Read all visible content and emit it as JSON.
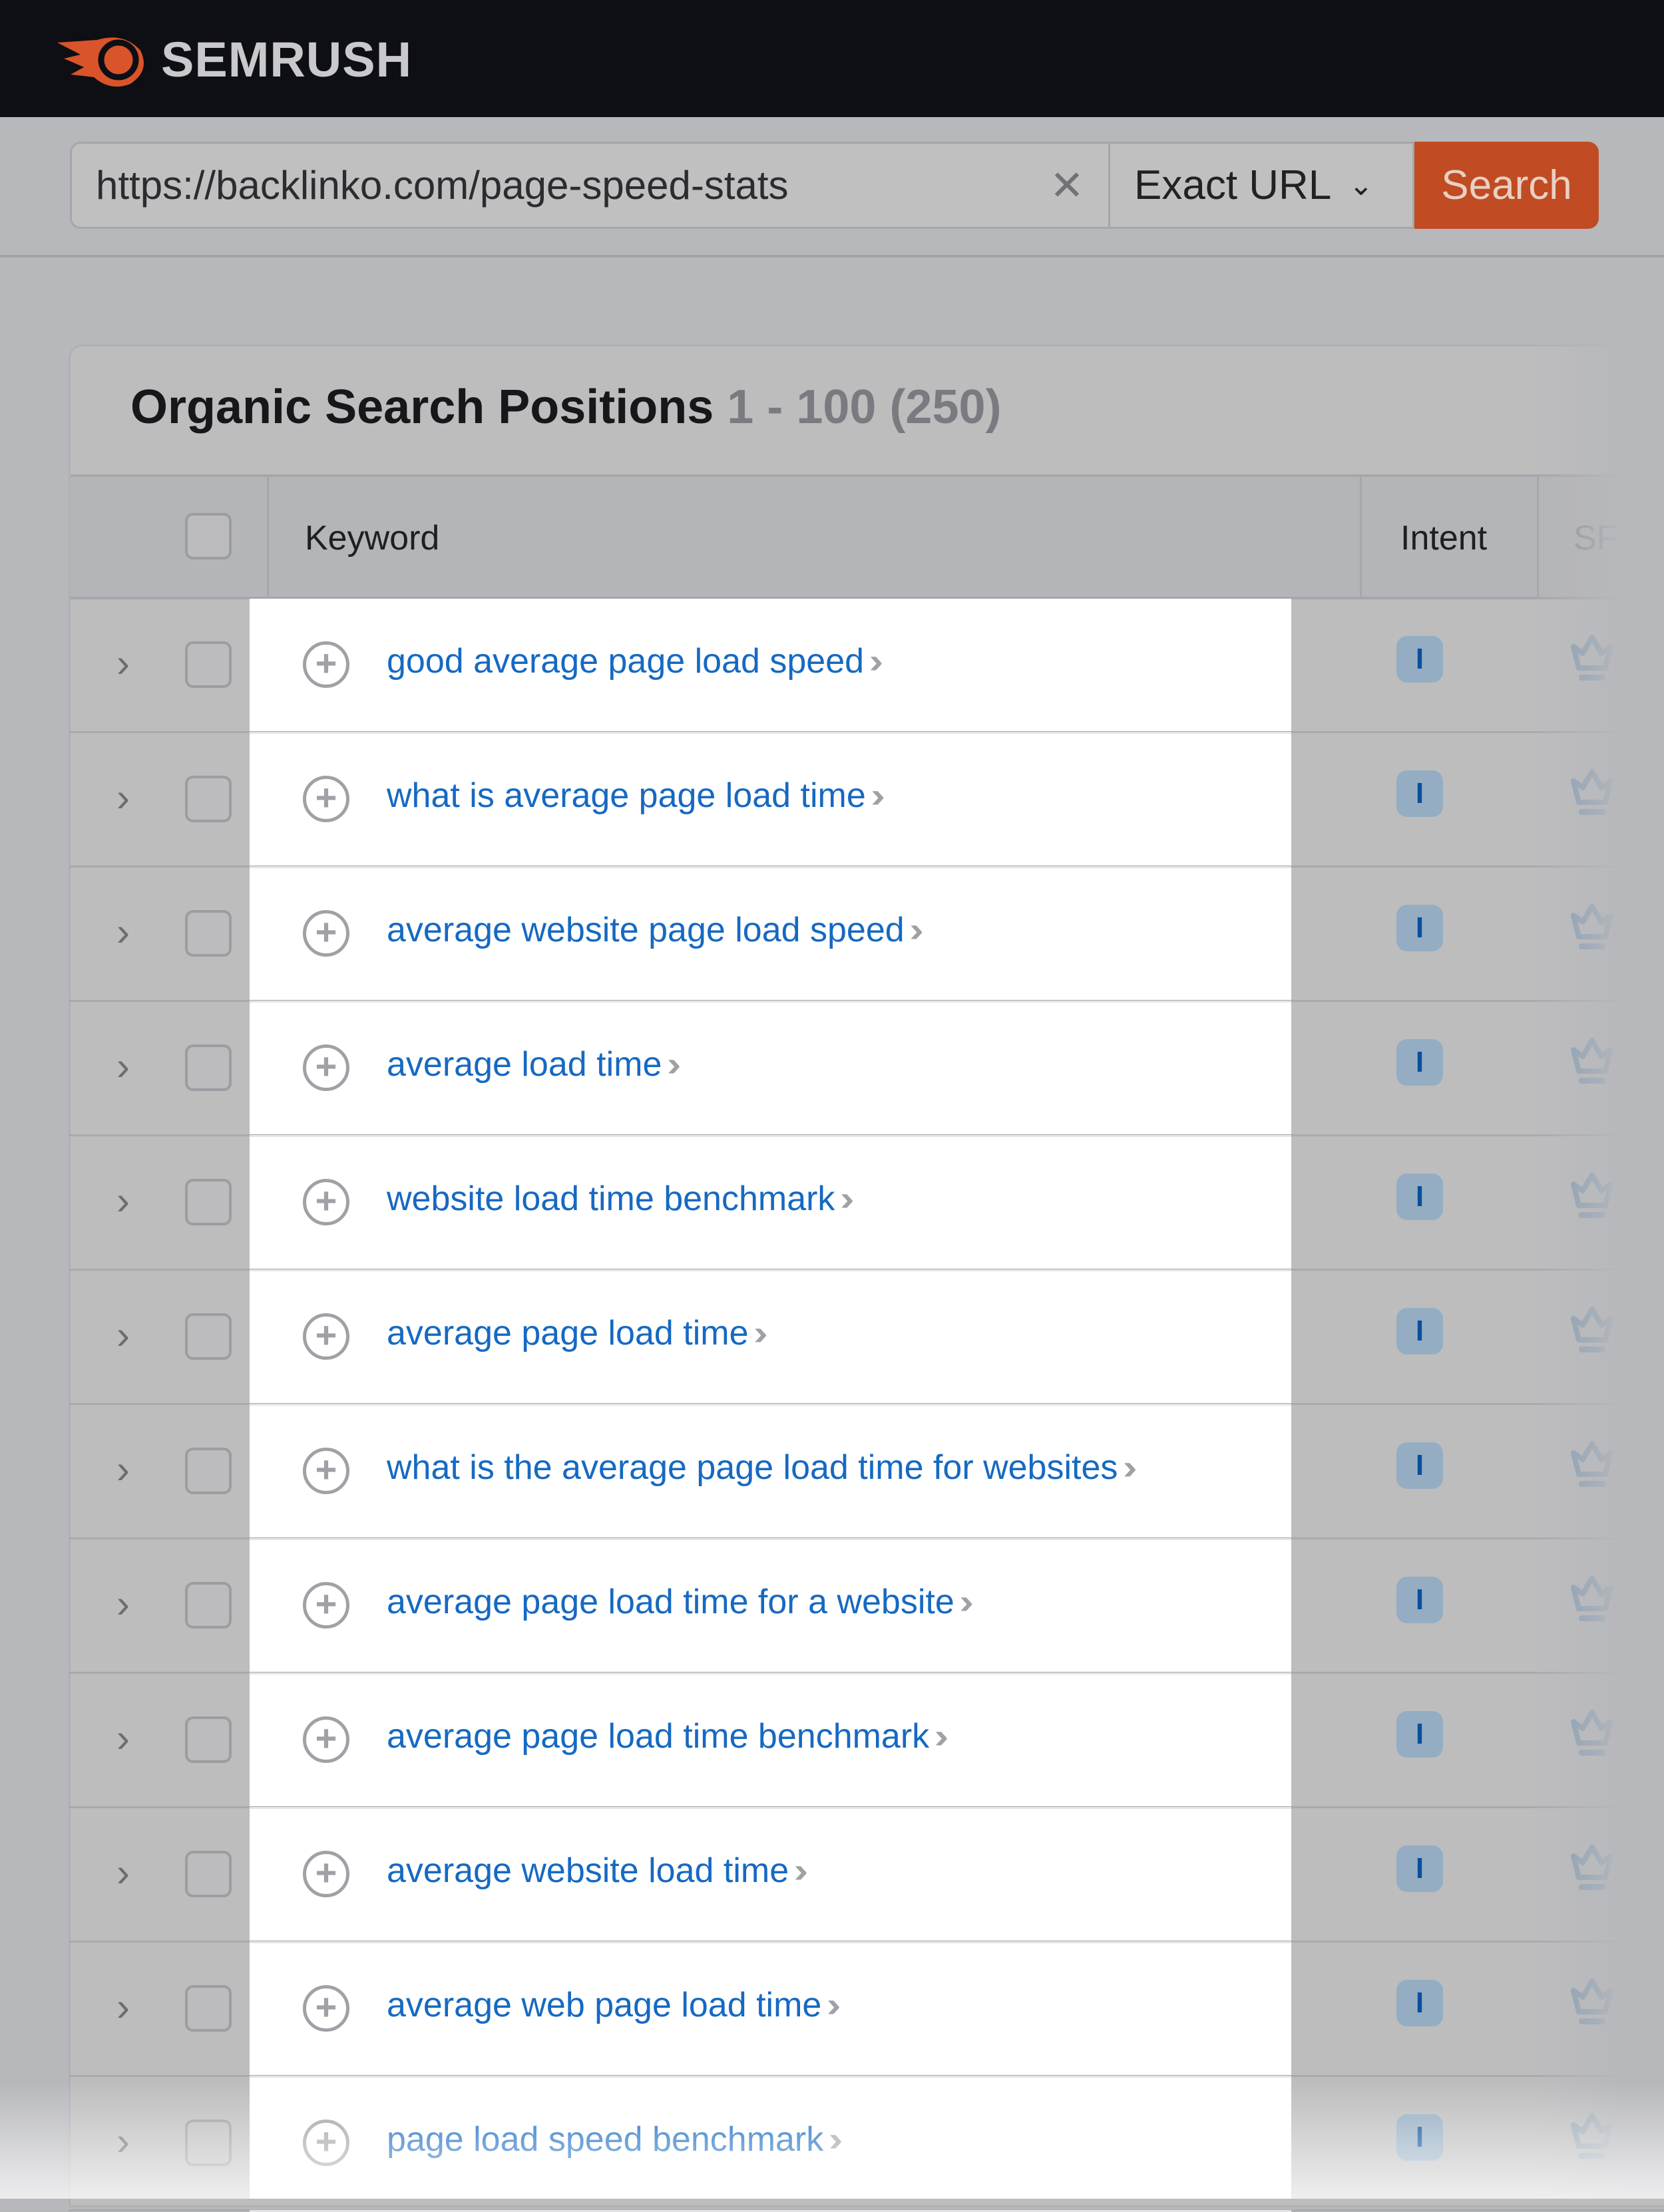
{
  "brand": {
    "name": "SEMRUSH",
    "accent": "#c14b22"
  },
  "search": {
    "url_value": "https://backlinko.com/page-speed-stats",
    "clear_icon": "close-icon",
    "scope": "Exact URL",
    "button": "Search"
  },
  "report": {
    "title": "Organic Search Positions",
    "range": "1 - 100 (250)"
  },
  "table": {
    "headers": {
      "keyword": "Keyword",
      "intent": "Intent",
      "sf": "SF"
    },
    "rows": [
      {
        "keyword": "good average page load speed",
        "intent": "I"
      },
      {
        "keyword": "what is average page load time",
        "intent": "I"
      },
      {
        "keyword": "average website page load speed",
        "intent": "I"
      },
      {
        "keyword": "average load time",
        "intent": "I"
      },
      {
        "keyword": "website load time benchmark",
        "intent": "I"
      },
      {
        "keyword": "average page load time",
        "intent": "I"
      },
      {
        "keyword": "what is the average page load time for websites",
        "intent": "I"
      },
      {
        "keyword": "average page load time for a website",
        "intent": "I"
      },
      {
        "keyword": "average page load time benchmark",
        "intent": "I"
      },
      {
        "keyword": "average website load time",
        "intent": "I"
      },
      {
        "keyword": "average web page load time",
        "intent": "I"
      },
      {
        "keyword": "page load speed benchmark",
        "intent": "I"
      }
    ]
  }
}
